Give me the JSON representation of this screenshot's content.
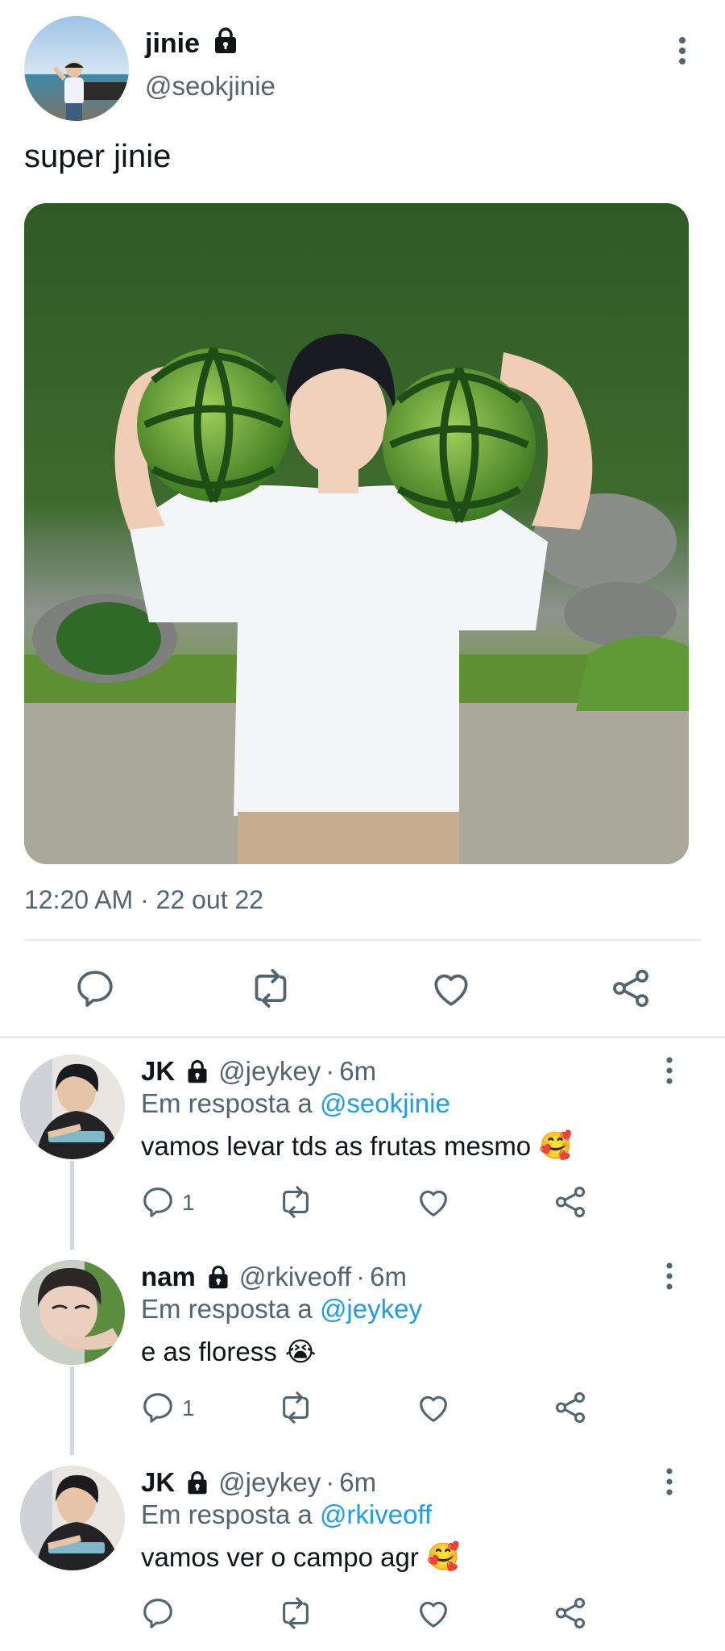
{
  "main_tweet": {
    "name": "jinie",
    "handle": "@seokjinie",
    "text": "super jinie",
    "timestamp": "12:20 AM · 22 out 22",
    "icons": [
      "lock-icon",
      "more-icon",
      "reply-icon",
      "retweet-icon",
      "like-icon",
      "share-icon"
    ]
  },
  "replies": [
    {
      "name": "JK",
      "handle": "@jeykey",
      "dot": "·",
      "time": "6m",
      "replying_prefix": "Em resposta a",
      "replying_to": "@seokjinie",
      "text": "vamos levar tds as frutas mesmo",
      "emoji": "🥰",
      "reply_count": "1"
    },
    {
      "name": "nam",
      "handle": "@rkiveoff",
      "dot": "·",
      "time": "6m",
      "replying_prefix": "Em resposta a",
      "replying_to": "@jeykey",
      "text": "e as floress",
      "emoji": "😭",
      "reply_count": "1"
    },
    {
      "name": "JK",
      "handle": "@jeykey",
      "dot": "·",
      "time": "6m",
      "replying_prefix": "Em resposta a",
      "replying_to": "@rkiveoff",
      "text": "vamos ver o campo agr",
      "emoji": "🥰",
      "reply_count": ""
    }
  ],
  "colors": {
    "text": "#0f1419",
    "secondary": "#536471",
    "link": "#1d9bf0",
    "divider": "#e6e9eb"
  }
}
